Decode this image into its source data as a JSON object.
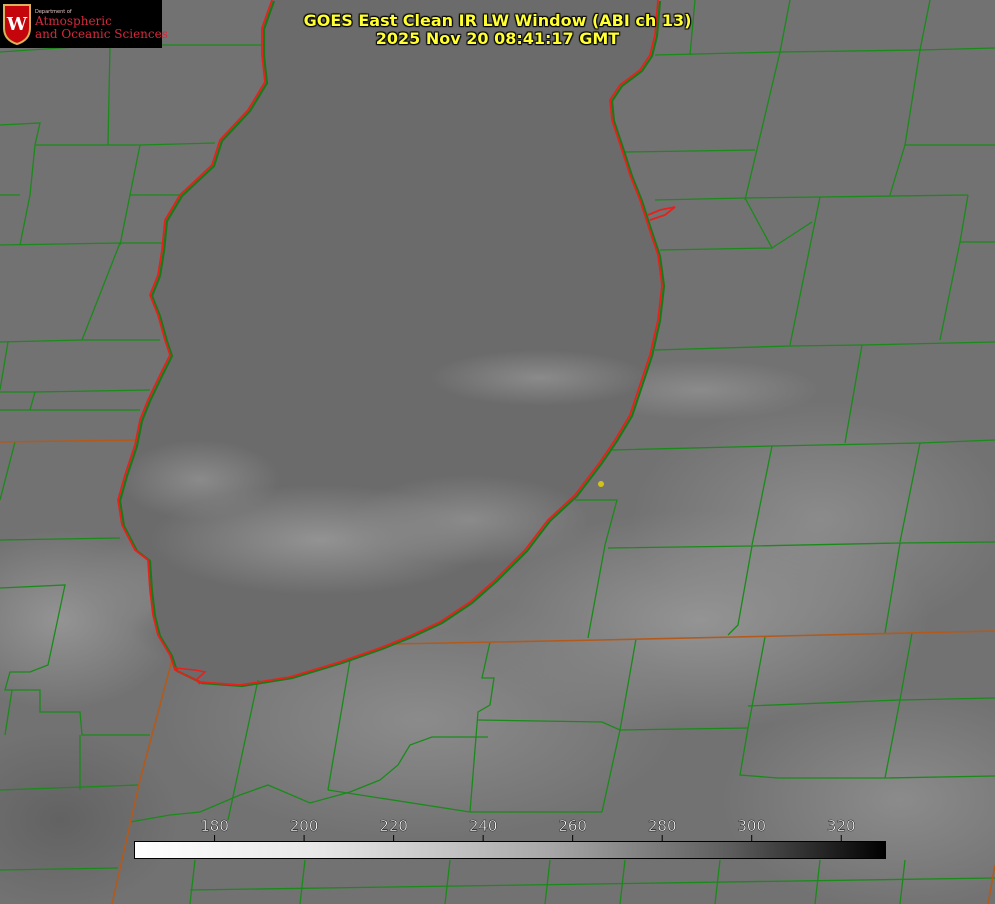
{
  "logo": {
    "department": "Department of",
    "line1": "Atmospheric",
    "line2": "and Oceanic Sciences",
    "crest_letter": "W",
    "crest_color": "#c5050c"
  },
  "title": {
    "line1": "GOES East Clean IR LW Window (ABI ch 13)",
    "line2": "2025 Nov 20 08:41:17 GMT"
  },
  "colorbar": {
    "min": 162,
    "max": 330,
    "ticks": [
      "180",
      "200",
      "220",
      "240",
      "260",
      "280",
      "300",
      "320"
    ]
  },
  "colors": {
    "coastline": "#e8201c",
    "county_lines": "#1a8a1a",
    "state_lines": "#b25a1c",
    "title_text": "#ffff33",
    "city_marker": "#d4c21a"
  }
}
